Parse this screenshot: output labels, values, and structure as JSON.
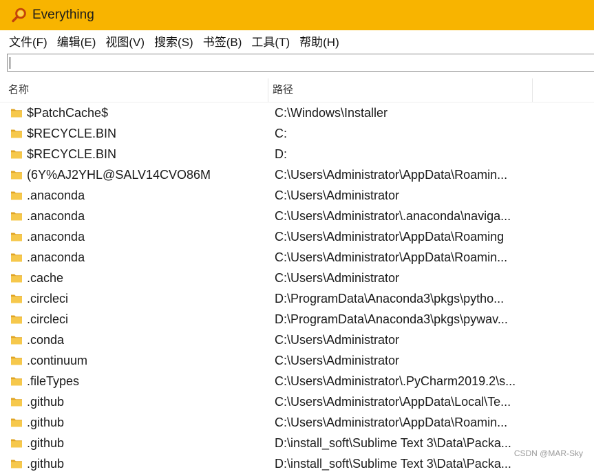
{
  "window": {
    "title": "Everything",
    "accent": "#f8b400",
    "app_icon": "magnifier-icon"
  },
  "menu": [
    "文件(F)",
    "编辑(E)",
    "视图(V)",
    "搜索(S)",
    "书签(B)",
    "工具(T)",
    "帮助(H)"
  ],
  "search": {
    "value": "",
    "placeholder": ""
  },
  "columns": {
    "name": "名称",
    "path": "路径"
  },
  "rows": [
    {
      "name": "$PatchCache$",
      "path": "C:\\Windows\\Installer"
    },
    {
      "name": "$RECYCLE.BIN",
      "path": "C:"
    },
    {
      "name": "$RECYCLE.BIN",
      "path": "D:"
    },
    {
      "name": "(6Y%AJ2YHL@SALV14CVO86M",
      "path": "C:\\Users\\Administrator\\AppData\\Roamin..."
    },
    {
      "name": ".anaconda",
      "path": "C:\\Users\\Administrator"
    },
    {
      "name": ".anaconda",
      "path": "C:\\Users\\Administrator\\.anaconda\\naviga..."
    },
    {
      "name": ".anaconda",
      "path": "C:\\Users\\Administrator\\AppData\\Roaming"
    },
    {
      "name": ".anaconda",
      "path": "C:\\Users\\Administrator\\AppData\\Roamin..."
    },
    {
      "name": ".cache",
      "path": "C:\\Users\\Administrator"
    },
    {
      "name": ".circleci",
      "path": "D:\\ProgramData\\Anaconda3\\pkgs\\pytho..."
    },
    {
      "name": ".circleci",
      "path": "D:\\ProgramData\\Anaconda3\\pkgs\\pywav..."
    },
    {
      "name": ".conda",
      "path": "C:\\Users\\Administrator"
    },
    {
      "name": ".continuum",
      "path": "C:\\Users\\Administrator"
    },
    {
      "name": ".fileTypes",
      "path": "C:\\Users\\Administrator\\.PyCharm2019.2\\s..."
    },
    {
      "name": ".github",
      "path": "C:\\Users\\Administrator\\AppData\\Local\\Te..."
    },
    {
      "name": ".github",
      "path": "C:\\Users\\Administrator\\AppData\\Roamin..."
    },
    {
      "name": ".github",
      "path": "D:\\install_soft\\Sublime Text 3\\Data\\Packa..."
    },
    {
      "name": ".github",
      "path": "D:\\install_soft\\Sublime Text 3\\Data\\Packa..."
    }
  ],
  "row_icon": "folder-icon",
  "watermark": "CSDN @MAR-Sky"
}
